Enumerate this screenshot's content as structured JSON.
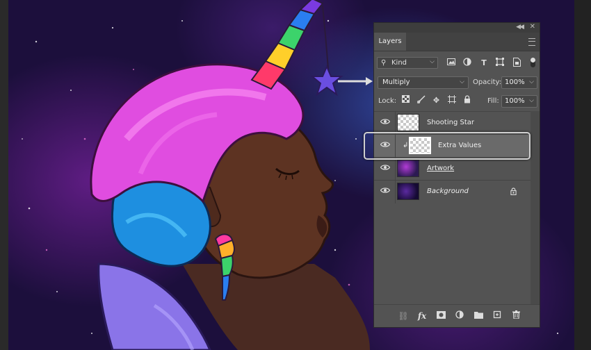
{
  "panel": {
    "tab_label": "Layers",
    "filter": {
      "kind_label": "Kind"
    },
    "blend_mode": "Multiply",
    "opacity_label": "Opacity:",
    "opacity_value": "100%",
    "lock_label": "Lock:",
    "fill_label": "Fill:",
    "fill_value": "100%"
  },
  "layers": [
    {
      "name": "Shooting Star",
      "visible": true,
      "thumb": "transparent"
    },
    {
      "name": "Extra Values",
      "visible": true,
      "thumb": "transparent",
      "clipped": true,
      "selected": true
    },
    {
      "name": "Artwork",
      "visible": true,
      "thumb": "artwork"
    },
    {
      "name": "Background",
      "visible": true,
      "thumb": "background",
      "locked": true
    }
  ],
  "colors": {
    "panel_bg": "#535353",
    "selected_row": "#6a6a6a",
    "canvas_bg": "#1c0f3c"
  }
}
